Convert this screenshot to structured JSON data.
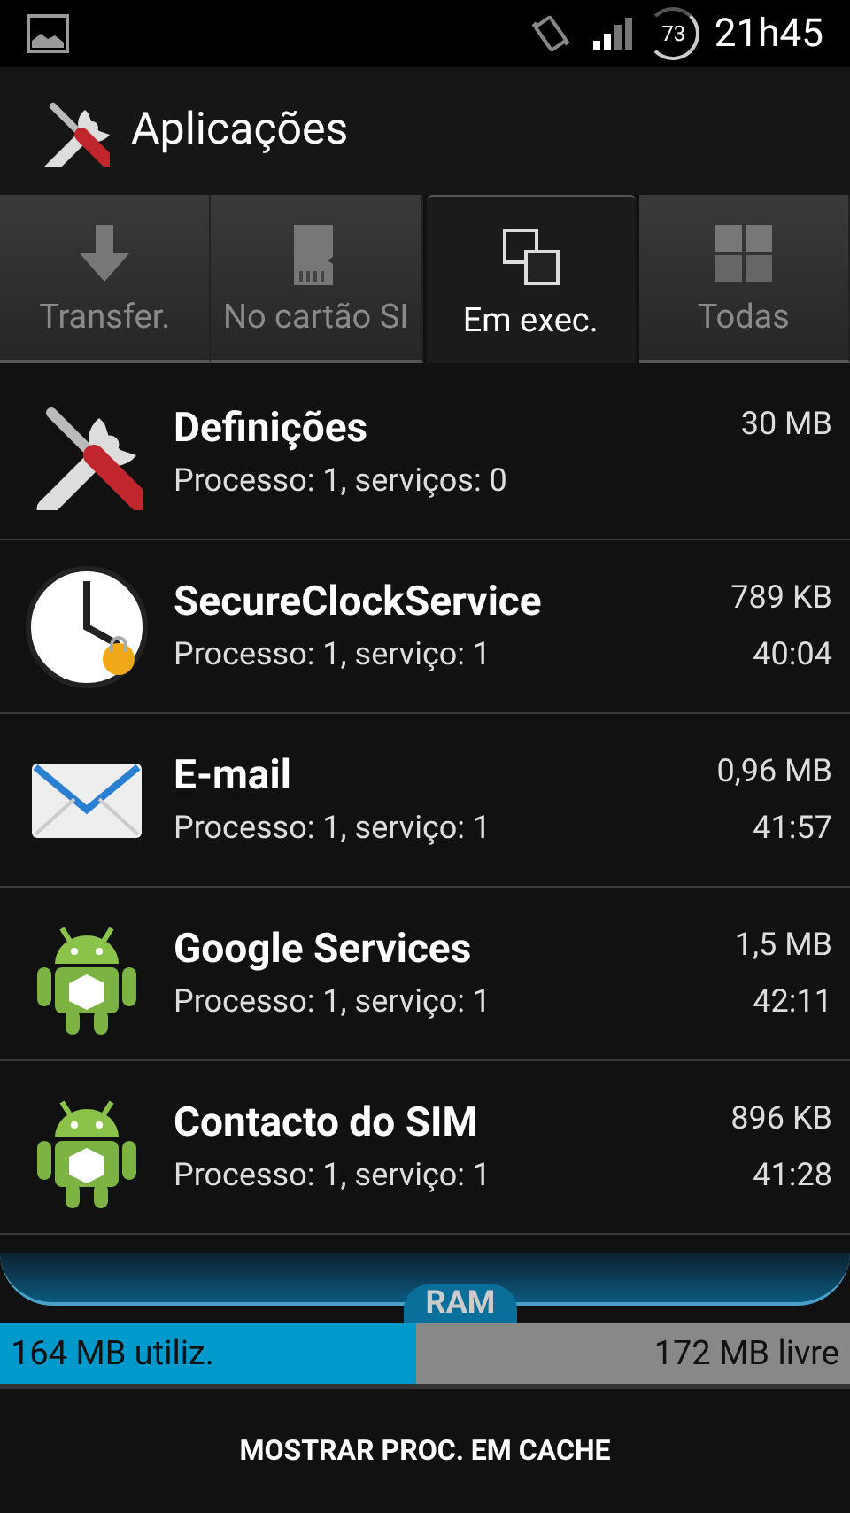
{
  "status_bar": {
    "battery": "73",
    "time": "21h45"
  },
  "action_bar": {
    "title": "Aplicações"
  },
  "tabs": [
    {
      "label": "Transfer.",
      "kind": "download",
      "selected": false
    },
    {
      "label": "No cartão SI",
      "kind": "sdcard",
      "selected": false
    },
    {
      "label": "Em exec.",
      "kind": "windows",
      "selected": true
    },
    {
      "label": "Todas",
      "kind": "grid",
      "selected": false
    }
  ],
  "processes": [
    {
      "kind": "tools",
      "name": "Definições",
      "size": "30 MB",
      "detail": "Processo: 1, serviços: 0"
    },
    {
      "kind": "clock",
      "name": "SecureClockService",
      "size": "789 KB",
      "detail": "Processo: 1, serviço: 1",
      "time": "40:04"
    },
    {
      "kind": "mail",
      "name": "E-mail",
      "size": "0,96 MB",
      "detail": "Processo: 1, serviço: 1",
      "time": "41:57"
    },
    {
      "kind": "android",
      "name": "Google Services",
      "size": "1,5 MB",
      "detail": "Processo: 1, serviço: 1",
      "time": "42:11"
    },
    {
      "kind": "android",
      "name": "Contacto do SIM",
      "size": "896 KB",
      "detail": "Processo: 1, serviço: 1",
      "time": "41:28"
    }
  ],
  "ram": {
    "label": "RAM",
    "level": 0.49,
    "used": "164 MB utiliz.",
    "free": "172 MB livre"
  },
  "footer_button": "MOSTRAR PROC. EM CACHE"
}
